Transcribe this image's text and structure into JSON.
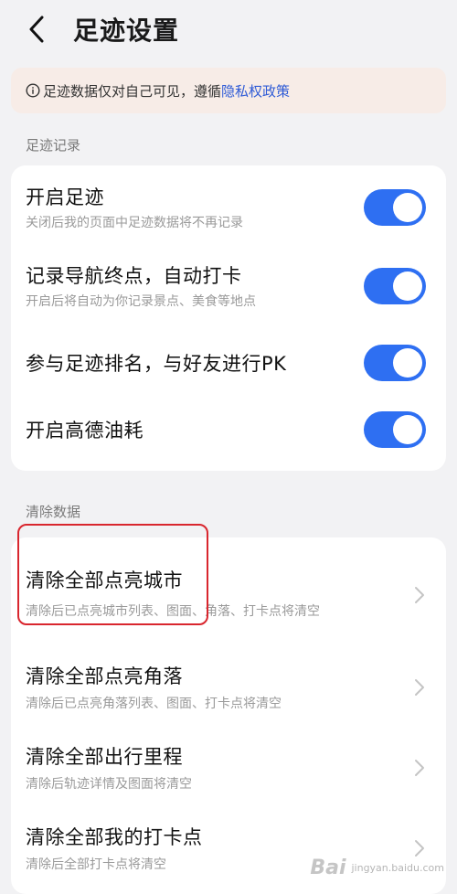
{
  "header": {
    "title": "足迹设置"
  },
  "notice": {
    "text": "足迹数据仅对自己可见，遵循",
    "link": "隐私权政策"
  },
  "sections": {
    "record": {
      "label": "足迹记录",
      "items": [
        {
          "title": "开启足迹",
          "desc": "关闭后我的页面中足迹数据将不再记录",
          "enabled": true
        },
        {
          "title": "记录导航终点，自动打卡",
          "desc": "开启后将自动为你记录景点、美食等地点",
          "enabled": true
        },
        {
          "title": "参与足迹排名，与好友进行PK",
          "desc": "",
          "enabled": true
        },
        {
          "title": "开启高德油耗",
          "desc": "",
          "enabled": true
        }
      ]
    },
    "clear": {
      "label": "清除数据",
      "items": [
        {
          "title": "清除全部点亮城市",
          "desc": "清除后已点亮城市列表、图面、角落、打卡点将清空"
        },
        {
          "title": "清除全部点亮角落",
          "desc": "清除后已点亮角落列表、图面、打卡点将清空"
        },
        {
          "title": "清除全部出行里程",
          "desc": "清除后轨迹详情及图面将清空"
        },
        {
          "title": "清除全部我的打卡点",
          "desc": "清除后全部打卡点将清空"
        }
      ]
    }
  },
  "watermark": {
    "text": "Bai",
    "sub": "jingyan.baidu.com"
  },
  "colors": {
    "toggle_on": "#2e6ff2",
    "link": "#2f5bd6",
    "highlight": "#d9262e",
    "notice_bg": "#f7ece7"
  }
}
